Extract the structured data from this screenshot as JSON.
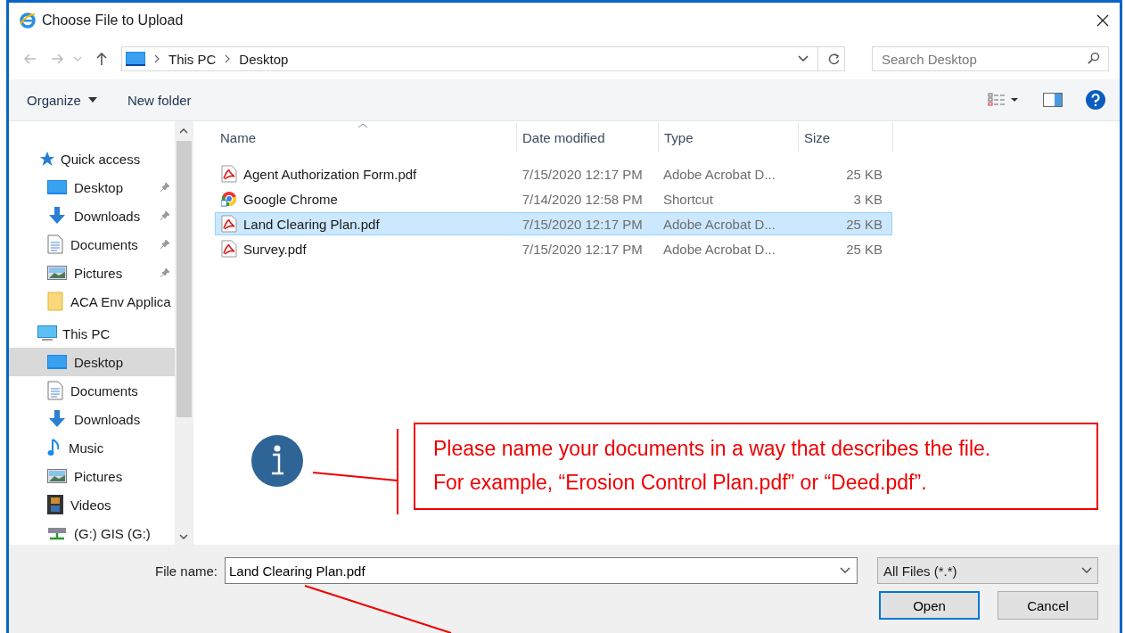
{
  "window": {
    "title": "Choose File to Upload"
  },
  "address": {
    "path": [
      "This PC",
      "Desktop"
    ]
  },
  "search": {
    "placeholder": "Search Desktop"
  },
  "toolbar": {
    "organize": "Organize",
    "new_folder": "New folder"
  },
  "sidebar": {
    "groups": [
      {
        "label": "Quick access",
        "kind": "quick",
        "children": [
          {
            "label": "Desktop",
            "kind": "desktop",
            "pinned": true,
            "selected": false
          },
          {
            "label": "Downloads",
            "kind": "downloads",
            "pinned": true,
            "selected": false
          },
          {
            "label": "Documents",
            "kind": "documents",
            "pinned": true,
            "selected": false
          },
          {
            "label": "Pictures",
            "kind": "pictures",
            "pinned": true,
            "selected": false
          },
          {
            "label": "ACA Env Applica",
            "kind": "folder",
            "pinned": false,
            "selected": false
          }
        ]
      },
      {
        "label": "This PC",
        "kind": "pc",
        "children": [
          {
            "label": "Desktop",
            "kind": "desktop",
            "pinned": false,
            "selected": true
          },
          {
            "label": "Documents",
            "kind": "documents",
            "pinned": false,
            "selected": false
          },
          {
            "label": "Downloads",
            "kind": "downloads",
            "pinned": false,
            "selected": false
          },
          {
            "label": "Music",
            "kind": "music",
            "pinned": false,
            "selected": false
          },
          {
            "label": "Pictures",
            "kind": "pictures",
            "pinned": false,
            "selected": false
          },
          {
            "label": "Videos",
            "kind": "videos",
            "pinned": false,
            "selected": false
          },
          {
            "label": "(G:) GIS (G:)",
            "kind": "drive",
            "pinned": false,
            "selected": false
          }
        ]
      }
    ]
  },
  "table": {
    "columns": [
      "Name",
      "Date modified",
      "Type",
      "Size"
    ],
    "rows": [
      {
        "name": "Agent Authorization Form.pdf",
        "kind": "pdf",
        "date": "7/15/2020 12:17 PM",
        "type": "Adobe Acrobat D...",
        "size": "25 KB",
        "selected": false
      },
      {
        "name": "Google Chrome",
        "kind": "shortcut",
        "date": "7/14/2020 12:58 PM",
        "type": "Shortcut",
        "size": "3 KB",
        "selected": false
      },
      {
        "name": "Land Clearing Plan.pdf",
        "kind": "pdf",
        "date": "7/15/2020 12:17 PM",
        "type": "Adobe Acrobat D...",
        "size": "25 KB",
        "selected": true
      },
      {
        "name": "Survey.pdf",
        "kind": "pdf",
        "date": "7/15/2020 12:17 PM",
        "type": "Adobe Acrobat D...",
        "size": "25 KB",
        "selected": false
      }
    ]
  },
  "annotation": {
    "text": "Please name your documents in a way that describes the file. For example, “Erosion Control Plan.pdf” or “Deed.pdf”."
  },
  "footer": {
    "file_name_label": "File name:",
    "file_name": "Land Clearing Plan.pdf",
    "filter": "All Files (*.*)",
    "buttons": [
      "Open",
      "Cancel"
    ]
  }
}
